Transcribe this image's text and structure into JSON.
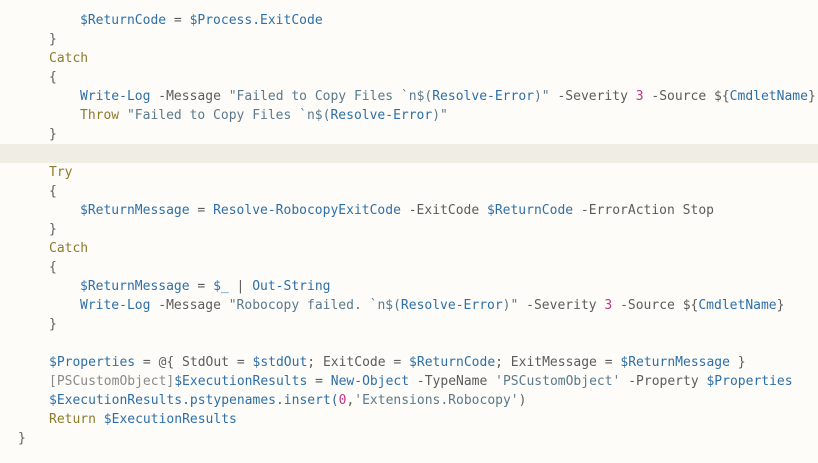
{
  "editor": {
    "colors": {
      "background": "#fdfcf8",
      "current_line": "#efede4",
      "variable": "#2e6fa8",
      "keyword": "#8c7b2c",
      "string": "#5a7a8c",
      "number": "#c2367f",
      "plain": "#5c5c5c"
    },
    "lines": [
      {
        "indent": 2,
        "highlight": false,
        "tokens": [
          {
            "t": "$ReturnCode",
            "k": "var"
          },
          {
            "t": " = ",
            "k": "plain"
          },
          {
            "t": "$Process",
            "k": "var"
          },
          {
            "t": ".ExitCode",
            "k": "var"
          }
        ]
      },
      {
        "indent": 1,
        "highlight": false,
        "tokens": [
          {
            "t": "}",
            "k": "plain"
          }
        ]
      },
      {
        "indent": 1,
        "highlight": false,
        "tokens": [
          {
            "t": "Catch",
            "k": "kw"
          }
        ]
      },
      {
        "indent": 1,
        "highlight": false,
        "tokens": [
          {
            "t": "{",
            "k": "plain"
          }
        ]
      },
      {
        "indent": 2,
        "highlight": false,
        "tokens": [
          {
            "t": "Write-Log",
            "k": "fn"
          },
          {
            "t": " -Message ",
            "k": "plain"
          },
          {
            "t": "\"Failed to Copy Files `n$(",
            "k": "str"
          },
          {
            "t": "Resolve-Error",
            "k": "fn"
          },
          {
            "t": ")\"",
            "k": "str"
          },
          {
            "t": " -Severity ",
            "k": "plain"
          },
          {
            "t": "3",
            "k": "num"
          },
          {
            "t": " -Source ",
            "k": "plain"
          },
          {
            "t": "${",
            "k": "plain"
          },
          {
            "t": "CmdletName",
            "k": "var"
          },
          {
            "t": "}",
            "k": "plain"
          }
        ]
      },
      {
        "indent": 2,
        "highlight": false,
        "tokens": [
          {
            "t": "Throw",
            "k": "kw"
          },
          {
            "t": " \"Failed to Copy Files `n$(",
            "k": "str"
          },
          {
            "t": "Resolve-Error",
            "k": "fn"
          },
          {
            "t": ")\"",
            "k": "str"
          }
        ]
      },
      {
        "indent": 1,
        "highlight": false,
        "tokens": [
          {
            "t": "}",
            "k": "plain"
          }
        ]
      },
      {
        "indent": 0,
        "highlight": true,
        "tokens": []
      },
      {
        "indent": 1,
        "highlight": false,
        "tokens": [
          {
            "t": "Try",
            "k": "kw"
          }
        ]
      },
      {
        "indent": 1,
        "highlight": false,
        "tokens": [
          {
            "t": "{",
            "k": "plain"
          }
        ]
      },
      {
        "indent": 2,
        "highlight": false,
        "tokens": [
          {
            "t": "$ReturnMessage",
            "k": "var"
          },
          {
            "t": " = ",
            "k": "plain"
          },
          {
            "t": "Resolve-RobocopyExitCode",
            "k": "fn"
          },
          {
            "t": " -ExitCode ",
            "k": "plain"
          },
          {
            "t": "$ReturnCode",
            "k": "var"
          },
          {
            "t": " -ErrorAction Stop",
            "k": "plain"
          }
        ]
      },
      {
        "indent": 1,
        "highlight": false,
        "tokens": [
          {
            "t": "}",
            "k": "plain"
          }
        ]
      },
      {
        "indent": 1,
        "highlight": false,
        "tokens": [
          {
            "t": "Catch",
            "k": "kw"
          }
        ]
      },
      {
        "indent": 1,
        "highlight": false,
        "tokens": [
          {
            "t": "{",
            "k": "plain"
          }
        ]
      },
      {
        "indent": 2,
        "highlight": false,
        "tokens": [
          {
            "t": "$ReturnMessage",
            "k": "var"
          },
          {
            "t": " = ",
            "k": "plain"
          },
          {
            "t": "$_",
            "k": "var"
          },
          {
            "t": " | ",
            "k": "plain"
          },
          {
            "t": "Out-String",
            "k": "fn"
          }
        ]
      },
      {
        "indent": 2,
        "highlight": false,
        "tokens": [
          {
            "t": "Write-Log",
            "k": "fn"
          },
          {
            "t": " -Message ",
            "k": "plain"
          },
          {
            "t": "\"Robocopy failed. `n$(",
            "k": "str"
          },
          {
            "t": "Resolve-Error",
            "k": "fn"
          },
          {
            "t": ")\"",
            "k": "str"
          },
          {
            "t": " -Severity ",
            "k": "plain"
          },
          {
            "t": "3",
            "k": "num"
          },
          {
            "t": " -Source ",
            "k": "plain"
          },
          {
            "t": "${",
            "k": "plain"
          },
          {
            "t": "CmdletName",
            "k": "var"
          },
          {
            "t": "}",
            "k": "plain"
          }
        ]
      },
      {
        "indent": 1,
        "highlight": false,
        "tokens": [
          {
            "t": "}",
            "k": "plain"
          }
        ]
      },
      {
        "indent": 0,
        "highlight": false,
        "tokens": []
      },
      {
        "indent": 1,
        "highlight": false,
        "tokens": [
          {
            "t": "$Properties",
            "k": "var"
          },
          {
            "t": " = @{ StdOut = ",
            "k": "plain"
          },
          {
            "t": "$stdOut",
            "k": "var"
          },
          {
            "t": "; ExitCode = ",
            "k": "plain"
          },
          {
            "t": "$ReturnCode",
            "k": "var"
          },
          {
            "t": "; ExitMessage = ",
            "k": "plain"
          },
          {
            "t": "$ReturnMessage",
            "k": "var"
          },
          {
            "t": " }",
            "k": "plain"
          }
        ]
      },
      {
        "indent": 1,
        "highlight": false,
        "tokens": [
          {
            "t": "[PSCustomObject]",
            "k": "type"
          },
          {
            "t": "$ExecutionResults",
            "k": "var"
          },
          {
            "t": " = ",
            "k": "plain"
          },
          {
            "t": "New-Object",
            "k": "fn"
          },
          {
            "t": " -TypeName ",
            "k": "plain"
          },
          {
            "t": "'PSCustomObject'",
            "k": "str"
          },
          {
            "t": " -Property ",
            "k": "plain"
          },
          {
            "t": "$Properties",
            "k": "var"
          }
        ]
      },
      {
        "indent": 1,
        "highlight": false,
        "tokens": [
          {
            "t": "$ExecutionResults",
            "k": "var"
          },
          {
            "t": ".pstypenames.insert(",
            "k": "var"
          },
          {
            "t": "0",
            "k": "num"
          },
          {
            "t": ",",
            "k": "plain"
          },
          {
            "t": "'Extensions.Robocopy'",
            "k": "str"
          },
          {
            "t": ")",
            "k": "plain"
          }
        ]
      },
      {
        "indent": 1,
        "highlight": false,
        "tokens": [
          {
            "t": "Return",
            "k": "kw"
          },
          {
            "t": " ",
            "k": "plain"
          },
          {
            "t": "$ExecutionResults",
            "k": "var"
          }
        ]
      },
      {
        "indent": 0,
        "highlight": false,
        "tokens": [
          {
            "t": "}",
            "k": "plain"
          }
        ]
      }
    ]
  }
}
